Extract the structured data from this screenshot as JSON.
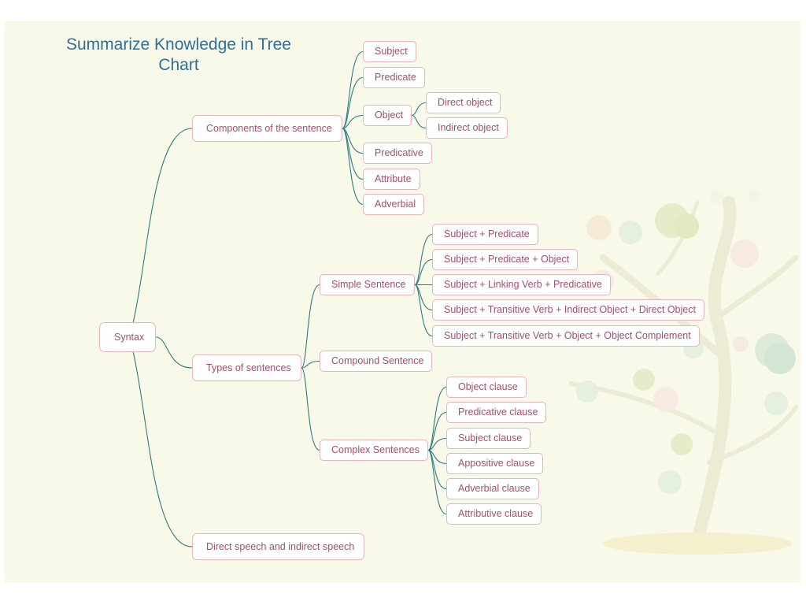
{
  "title": "Summarize Knowledge in Tree Chart",
  "colors": {
    "link": "#2e7a84",
    "node_text": "#a0506f",
    "node_border": "#e2b5bf",
    "title": "#2f6f97",
    "background": "#f8f9e8"
  },
  "tree": {
    "root": "Syntax",
    "components": {
      "label": "Components of the sentence",
      "subject": "Subject",
      "predicate": "Predicate",
      "object": "Object",
      "direct_object": "Direct object",
      "indirect_object": "Indirect object",
      "predicative": "Predicative",
      "attribute": "Attribute",
      "adverbial": "Adverbial"
    },
    "types": {
      "label": "Types of sentences",
      "simple": {
        "label": "Simple Sentence",
        "patterns": [
          "Subject + Predicate",
          "Subject + Predicate + Object",
          "Subject + Linking Verb + Predicative",
          "Subject + Transitive Verb + Indirect Object + Direct Object",
          "Subject + Transitive Verb + Object + Object Complement"
        ]
      },
      "compound": "Compound Sentence",
      "complex": {
        "label": "Complex Sentences",
        "clauses": [
          "Object clause",
          "Predicative clause",
          "Subject clause",
          "Appositive clause",
          "Adverbial clause",
          "Attributive clause"
        ]
      }
    },
    "speech": "Direct speech and indirect speech"
  }
}
